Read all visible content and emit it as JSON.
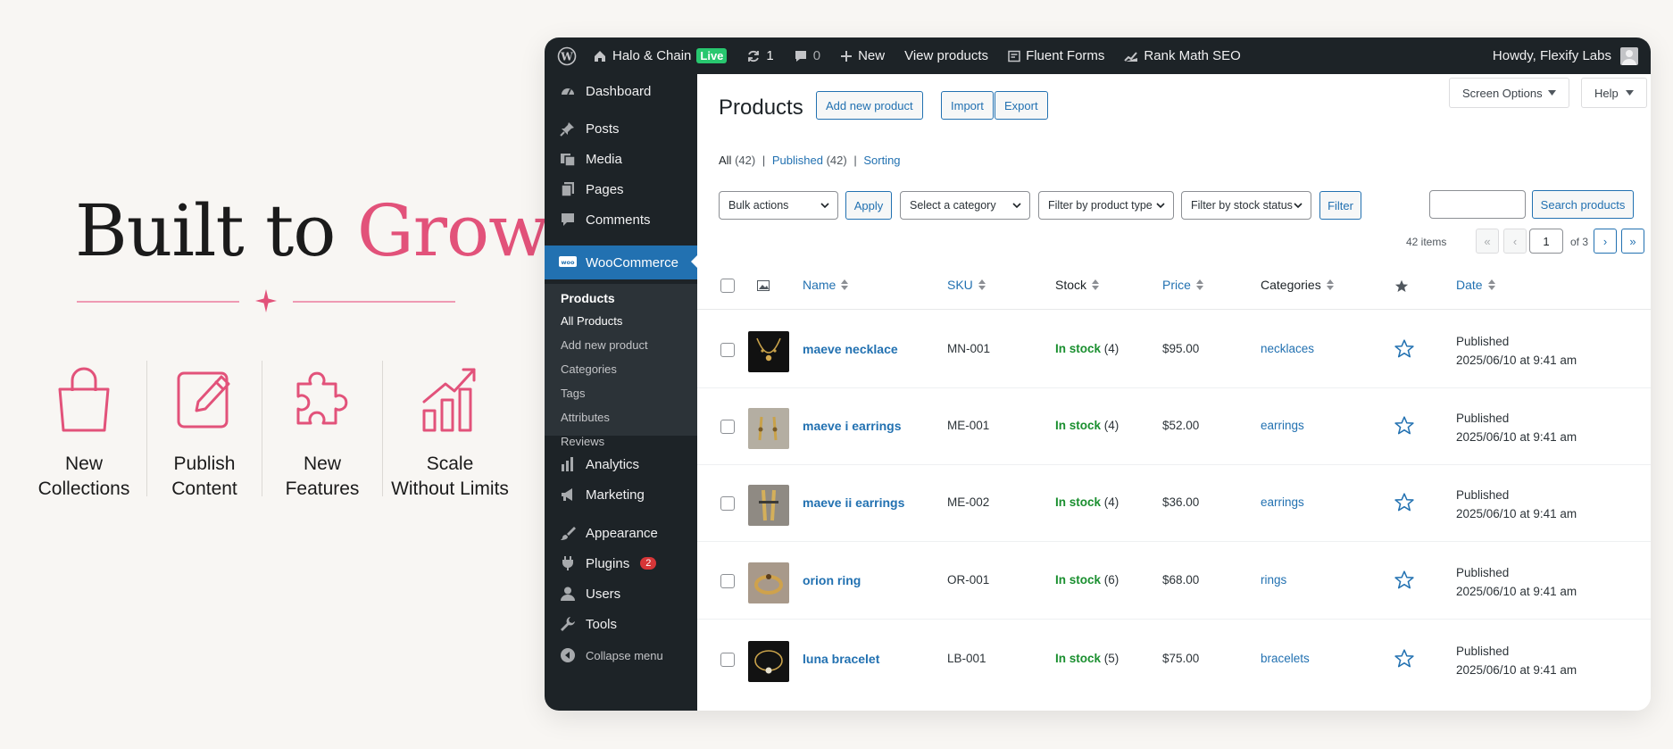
{
  "promo": {
    "title_part1": "Built to",
    "title_part2": "Grow",
    "accent_color": "#e2527a",
    "features": [
      {
        "icon": "shopping-bag-icon",
        "line1": "New",
        "line2": "Collections"
      },
      {
        "icon": "edit-icon",
        "line1": "Publish",
        "line2": "Content"
      },
      {
        "icon": "puzzle-icon",
        "line1": "New",
        "line2": "Features"
      },
      {
        "icon": "growth-chart-icon",
        "line1": "Scale",
        "line2": "Without Limits"
      }
    ]
  },
  "admin_bar": {
    "site_name": "Halo & Chain",
    "live_label": "Live",
    "updates_count": "1",
    "comments_count": "0",
    "new_label": "New",
    "view_products": "View products",
    "fluent_forms": "Fluent Forms",
    "rank_math": "Rank Math SEO",
    "howdy": "Howdy, Flexify Labs"
  },
  "sidebar": {
    "dashboard": "Dashboard",
    "posts": "Posts",
    "media": "Media",
    "pages": "Pages",
    "comments": "Comments",
    "woocommerce": "WooCommerce",
    "sub_head": "Products",
    "sub_items": [
      "All Products",
      "Add new product",
      "Categories",
      "Tags",
      "Attributes",
      "Reviews"
    ],
    "analytics": "Analytics",
    "marketing": "Marketing",
    "appearance": "Appearance",
    "plugins": "Plugins",
    "plugins_badge": "2",
    "users": "Users",
    "tools": "Tools",
    "collapse": "Collapse menu"
  },
  "page": {
    "title": "Products",
    "add_new": "Add new product",
    "import": "Import",
    "export": "Export",
    "screen_options": "Screen Options",
    "help": "Help",
    "view_all": "All",
    "view_all_count": "(42)",
    "view_published": "Published",
    "view_published_count": "(42)",
    "view_sorting": "Sorting",
    "bulk_actions": "Bulk actions",
    "apply": "Apply",
    "select_category": "Select a category",
    "filter_type": "Filter by product type",
    "filter_stock": "Filter by stock status",
    "filter": "Filter",
    "search_button": "Search products",
    "items_count": "42 items",
    "current_page": "1",
    "of_pages": "of 3"
  },
  "table": {
    "headers": {
      "name": "Name",
      "sku": "SKU",
      "stock": "Stock",
      "price": "Price",
      "categories": "Categories",
      "date": "Date"
    },
    "rows": [
      {
        "name": "maeve necklace",
        "sku": "MN-001",
        "stock_status": "In stock",
        "stock_qty": "(4)",
        "price": "$95.00",
        "category": "necklaces",
        "status": "Published",
        "date": "2025/06/10 at 9:41 am"
      },
      {
        "name": "maeve i earrings",
        "sku": "ME-001",
        "stock_status": "In stock",
        "stock_qty": "(4)",
        "price": "$52.00",
        "category": "earrings",
        "status": "Published",
        "date": "2025/06/10 at 9:41 am"
      },
      {
        "name": "maeve ii earrings",
        "sku": "ME-002",
        "stock_status": "In stock",
        "stock_qty": "(4)",
        "price": "$36.00",
        "category": "earrings",
        "status": "Published",
        "date": "2025/06/10 at 9:41 am"
      },
      {
        "name": "orion ring",
        "sku": "OR-001",
        "stock_status": "In stock",
        "stock_qty": "(6)",
        "price": "$68.00",
        "category": "rings",
        "status": "Published",
        "date": "2025/06/10 at 9:41 am"
      },
      {
        "name": "luna bracelet",
        "sku": "LB-001",
        "stock_status": "In stock",
        "stock_qty": "(5)",
        "price": "$75.00",
        "category": "bracelets",
        "status": "Published",
        "date": "2025/06/10 at 9:41 am"
      }
    ]
  }
}
